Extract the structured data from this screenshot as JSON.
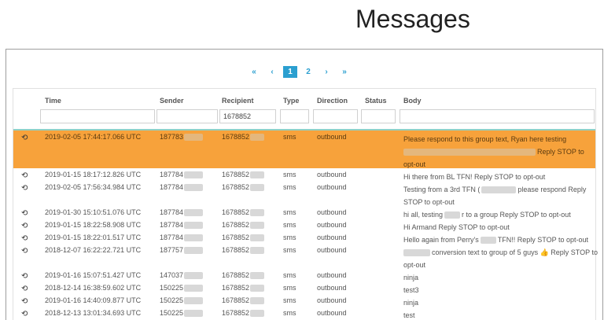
{
  "page_title": "Messages",
  "pagination": {
    "first": "«",
    "prev": "‹",
    "pages": [
      "1",
      "2"
    ],
    "active_page": "1",
    "next": "›",
    "last": "»"
  },
  "columns": [
    "Time",
    "Sender",
    "Recipient",
    "Type",
    "Direction",
    "Status",
    "Body"
  ],
  "filters": {
    "recipient": "1678852"
  },
  "rows": [
    {
      "time": "2019-02-05 17:44:17.066 UTC",
      "sender": "187783",
      "recipient": "1678852",
      "type": "sms",
      "direction": "outbound",
      "status": "",
      "body1": "Please respond to this group text, Ryan here testing",
      "body2": "Reply STOP to",
      "body3": "opt-out",
      "highlighted": true
    },
    {
      "time": "2019-01-15 18:17:12.826 UTC",
      "sender": "187784",
      "recipient": "1678852",
      "type": "sms",
      "direction": "outbound",
      "status": "",
      "body1": "Hi there from BL TFN! Reply STOP to opt-out"
    },
    {
      "time": "2019-02-05 17:56:34.984 UTC",
      "sender": "187784",
      "recipient": "1678852",
      "type": "sms",
      "direction": "outbound",
      "status": "",
      "body1": "Testing from a 3rd TFN (",
      "body1b": "please respond Reply",
      "body2": "STOP to opt-out"
    },
    {
      "time": "2019-01-30 15:10:51.076 UTC",
      "sender": "187784",
      "recipient": "1678852",
      "type": "sms",
      "direction": "outbound",
      "status": "",
      "body1": "hi all, testing",
      "body1b": "r to a group Reply STOP to opt-out"
    },
    {
      "time": "2019-01-15 18:22:58.908 UTC",
      "sender": "187784",
      "recipient": "1678852",
      "type": "sms",
      "direction": "outbound",
      "status": "",
      "body1": "Hi Armand Reply STOP to opt-out"
    },
    {
      "time": "2019-01-15 18:22:01.517 UTC",
      "sender": "187784",
      "recipient": "1678852",
      "type": "sms",
      "direction": "outbound",
      "status": "",
      "body1": "Hello again from Perry's",
      "body1b": "TFN!! Reply STOP to opt-out"
    },
    {
      "time": "2018-12-07 16:22:22.721 UTC",
      "sender": "187757",
      "recipient": "1678852",
      "type": "sms",
      "direction": "outbound",
      "status": "",
      "body1": "conversion text to group of 5 guys 👍 Reply STOP to",
      "body2": "opt-out"
    },
    {
      "time": "2019-01-16 15:07:51.427 UTC",
      "sender": "147037",
      "recipient": "1678852",
      "type": "sms",
      "direction": "outbound",
      "status": "",
      "body1": "ninja"
    },
    {
      "time": "2018-12-14 16:38:59.602 UTC",
      "sender": "150225",
      "recipient": "1678852",
      "type": "sms",
      "direction": "outbound",
      "status": "",
      "body1": "test3"
    },
    {
      "time": "2019-01-16 14:40:09.877 UTC",
      "sender": "150225",
      "recipient": "1678852",
      "type": "sms",
      "direction": "outbound",
      "status": "",
      "body1": "ninja"
    },
    {
      "time": "2018-12-13 13:01:34.693 UTC",
      "sender": "150225",
      "recipient": "1678852",
      "type": "sms",
      "direction": "outbound",
      "status": "",
      "body1": "test"
    }
  ],
  "icons": {
    "row_action": "history-icon"
  },
  "colors": {
    "highlight": "#f7a23b",
    "accent": "#2b9fd0",
    "separator": "#8fd0c7"
  }
}
